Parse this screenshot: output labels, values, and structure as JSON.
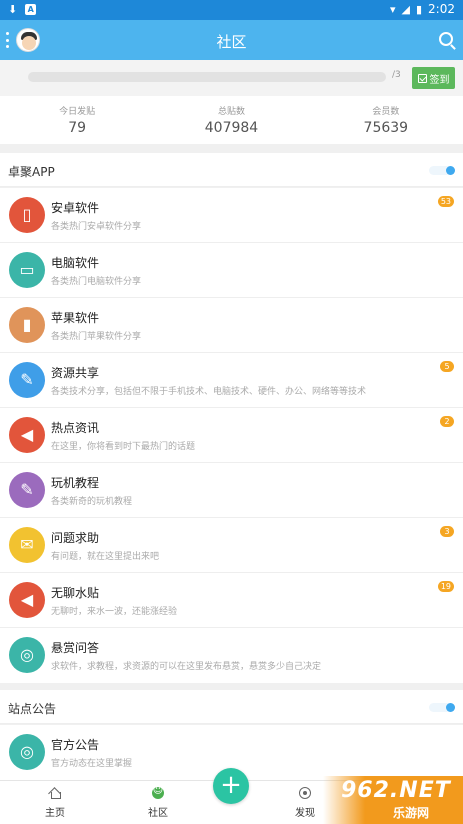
{
  "status_bar": {
    "time": "2:02"
  },
  "header": {
    "title": "社区"
  },
  "signin": {
    "progress_text": "/3",
    "button_label": "签到"
  },
  "stats": [
    {
      "label": "今日发贴",
      "value": "79"
    },
    {
      "label": "总贴数",
      "value": "407984"
    },
    {
      "label": "会员数",
      "value": "75639"
    }
  ],
  "section_app": {
    "title": "卓聚APP",
    "items": [
      {
        "name": "安卓软件",
        "desc": "各类热门安卓软件分享",
        "badge": "53",
        "color": "#e2553b",
        "icon": "phone-icon"
      },
      {
        "name": "电脑软件",
        "desc": "各类热门电脑软件分享",
        "badge": "",
        "color": "#3bb5a8",
        "icon": "monitor-icon"
      },
      {
        "name": "苹果软件",
        "desc": "各类热门苹果软件分享",
        "badge": "",
        "color": "#e0945a",
        "icon": "tablet-icon"
      },
      {
        "name": "资源共享",
        "desc": "各类技术分享，包括但不限于手机技术、电脑技术、硬件、办公、网络等等技术",
        "badge": "5",
        "color": "#3f9ee8",
        "icon": "wrench-icon"
      },
      {
        "name": "热点资讯",
        "desc": "在这里，你将看到时下最热门的话题",
        "badge": "2",
        "color": "#e2553b",
        "icon": "megaphone-icon"
      },
      {
        "name": "玩机教程",
        "desc": "各类新奇的玩机教程",
        "badge": "",
        "color": "#9b6bbd",
        "icon": "wrench-icon"
      },
      {
        "name": "问题求助",
        "desc": "有问题，就在这里提出来吧",
        "badge": "3",
        "color": "#f2c230",
        "icon": "envelope-icon"
      },
      {
        "name": "无聊水贴",
        "desc": "无聊时，来水一波，还能涨经验",
        "badge": "19",
        "color": "#e2553b",
        "icon": "megaphone-icon"
      },
      {
        "name": "悬赏问答",
        "desc": "求软件，求教程，求资源的可以在这里发布悬赏，悬赏多少自己决定",
        "badge": "",
        "color": "#3bb5a8",
        "icon": "lollipop-icon"
      }
    ]
  },
  "section_notice": {
    "title": "站点公告",
    "items": [
      {
        "name": "官方公告",
        "desc": "官方动态在这里掌握",
        "badge": "",
        "color": "#3bb5a8",
        "icon": "lollipop-icon"
      }
    ]
  },
  "bottom_nav": {
    "home": "主页",
    "community": "社区",
    "discover": "发现",
    "fab": "+"
  },
  "watermark": {
    "main": "962.NET",
    "sub": "乐游网"
  }
}
